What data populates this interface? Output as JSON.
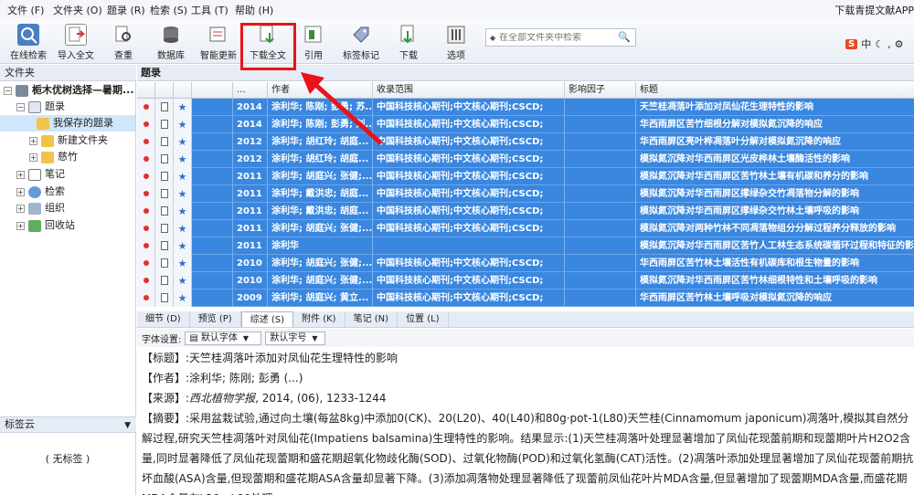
{
  "menu": {
    "items": [
      "文件 (F)",
      "文件夹 (O)",
      "题录 (R)",
      "检索 (S)",
      "工具 (T)",
      "帮助 (H)"
    ],
    "right": "下载青提文献APP"
  },
  "toolbar": {
    "buttons": [
      "在线检索",
      "导入全文",
      "查重",
      "数据库",
      "智能更新",
      "下载全文",
      "引用",
      "标签标记",
      "下载",
      "选项"
    ],
    "search_placeholder": "在全部文件夹中检索",
    "ime_label": "中"
  },
  "left_panel": {
    "header": "文件夹",
    "tree": {
      "root": "栀木优树选择—暑期...",
      "items": [
        "题录",
        "我保存的题录",
        "新建文件夹",
        "慈竹",
        "笔记",
        "检索",
        "组织",
        "回收站"
      ]
    },
    "tag_header": "标签云",
    "tag_empty": "( 无标签 )"
  },
  "main": {
    "header": "题录",
    "columns": [
      "...",
      "作者",
      "收录范围",
      "影响因子",
      "标题"
    ],
    "rows": [
      {
        "year": "2014",
        "author": "涂利华; 陈刚; 彭勇; 苏...",
        "scope": "中国科技核心期刊;中文核心期刊;CSCD;",
        "title": "天竺桂凋落叶添加对凤仙花生理特性的影响"
      },
      {
        "year": "2014",
        "author": "涂利华; 陈刚; 彭勇; 刘...",
        "scope": "中国科技核心期刊;中文核心期刊;CSCD;",
        "title": "华西雨屏区苦竹细根分解对模拟氮沉降的响应"
      },
      {
        "year": "2012",
        "author": "涂利华; 胡红玲; 胡庭...",
        "scope": "中国科技核心期刊;中文核心期刊;CSCD;",
        "title": "华西雨屏区亮叶桦凋落叶分解对模拟氮沉降的响应"
      },
      {
        "year": "2012",
        "author": "涂利华; 胡红玲; 胡庭...",
        "scope": "中国科技核心期刊;中文核心期刊;CSCD;",
        "title": "模拟氮沉降对华西雨屏区光皮桦林土壤酶活性的影响"
      },
      {
        "year": "2011",
        "author": "涂利华; 胡庭兴; 张健;...",
        "scope": "中国科技核心期刊;中文核心期刊;CSCD;",
        "title": "模拟氮沉降对华西雨屏区苦竹林土壤有机碳和养分的影响"
      },
      {
        "year": "2011",
        "author": "涂利华; 戴洪忠; 胡庭...",
        "scope": "中国科技核心期刊;中文核心期刊;CSCD;",
        "title": "模拟氮沉降对华西雨屏区撑绿杂交竹凋落物分解的影响"
      },
      {
        "year": "2011",
        "author": "涂利华; 戴洪忠; 胡庭...",
        "scope": "中国科技核心期刊;中文核心期刊;CSCD;",
        "title": "模拟氮沉降对华西雨屏区撑绿杂交竹林土壤呼吸的影响"
      },
      {
        "year": "2011",
        "author": "涂利华; 胡庭兴; 张健;...",
        "scope": "中国科技核心期刊;中文核心期刊;CSCD;",
        "title": "模拟氮沉降对两种竹林不同凋落物组分分解过程养分释放的影响"
      },
      {
        "year": "2011",
        "author": "涂利华",
        "scope": "",
        "title": "模拟氮沉降对华西雨屏区苦竹人工林生态系统碳循环过程和特征的影响"
      },
      {
        "year": "2010",
        "author": "涂利华; 胡庭兴; 张健;...",
        "scope": "中国科技核心期刊;中文核心期刊;CSCD;",
        "title": "华西雨屏区苦竹林土壤活性有机碳库和根生物量的影响"
      },
      {
        "year": "2010",
        "author": "涂利华; 胡庭兴; 张健;...",
        "scope": "中国科技核心期刊;中文核心期刊;CSCD;",
        "title": "模拟氮沉降对华西雨屏区苦竹林细根特性和土壤呼吸的影响"
      },
      {
        "year": "2009",
        "author": "涂利华; 胡庭兴; 黄立...",
        "scope": "中国科技核心期刊;中文核心期刊;CSCD;",
        "title": "华西雨屏区苦竹林土壤呼吸对模拟氮沉降的响应"
      }
    ]
  },
  "bottom_tabs": [
    "细节 (D)",
    "预览 (P)",
    "综述 (S)",
    "附件 (K)",
    "笔记 (N)",
    "位置 (L)"
  ],
  "font_bar": {
    "label": "字体设置:",
    "font": "默认字体",
    "size": "默认字号"
  },
  "detail": {
    "title_label": "【标题】:",
    "title_value": "天竺桂凋落叶添加对凤仙花生理特性的影响",
    "author_label": "【作者】:",
    "author_value": "涂利华; 陈刚; 彭勇 (...)",
    "source_label": "【来源】:",
    "source_journal": "西北植物学报",
    "source_rest": ", 2014, (06), 1233-1244",
    "abstract_label": "【摘要】:",
    "abstract_text": "采用盆栽试验,通过向土壤(每盆8kg)中添加0(CK)、20(L20)、40(L40)和80g·pot-1(L80)天竺桂(Cinnamomum japonicum)凋落叶,模拟其自然分解过程,研究天竺桂凋落叶对凤仙花(Impatiens balsamina)生理特性的影响。结果显示:(1)天竺桂凋落叶处理显著增加了凤仙花现蕾前期和现蕾期叶片H2O2含量,同时显著降低了凤仙花现蕾期和盛花期超氧化物歧化酶(SOD)、过氧化物酶(POD)和过氧化氢酶(CAT)活性。(2)凋落叶添加处理显著增加了凤仙花现蕾前期抗坏血酸(ASA)含量,但现蕾期和盛花期ASA含量却显著下降。(3)添加凋落物处理显著降低了现蕾前凤仙花叶片MDA含量,但显著增加了现蕾期MDA含量,而盛花期MDA含量在L20、L80处理"
  }
}
